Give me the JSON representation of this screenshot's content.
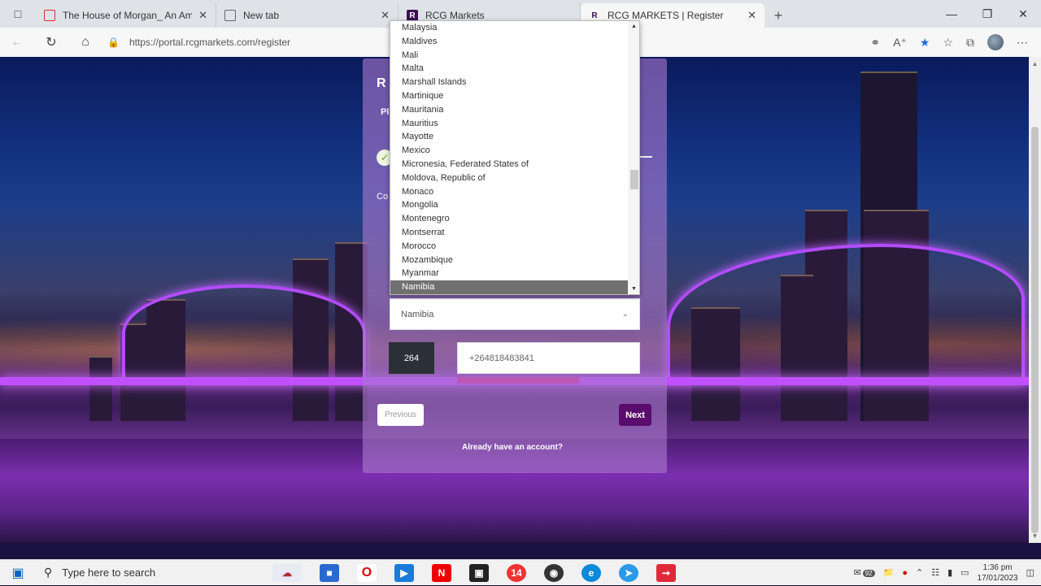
{
  "browser": {
    "tabs": [
      {
        "title": "The House of Morgan_ An Amer",
        "icon": "pdf-icon",
        "active": false
      },
      {
        "title": "New tab",
        "icon": "new-tab-icon",
        "active": false
      },
      {
        "title": "RCG Markets",
        "icon": "rcg-icon",
        "active": false
      },
      {
        "title": "RCG MARKETS | Register",
        "icon": "rcg-icon",
        "active": true
      }
    ],
    "url": "https://portal.rcgmarkets.com/register"
  },
  "modal": {
    "title": "R",
    "subtitle": "Pl",
    "country_label": "Co",
    "country_selected": "Namibia",
    "phone_code": "264",
    "phone_value": "+264818483841",
    "previous_label": "Previous",
    "next_label": "Next",
    "account_text": "Already have an account?"
  },
  "dropdown": {
    "options": [
      "Malaysia",
      "Maldives",
      "Mali",
      "Malta",
      "Marshall Islands",
      "Martinique",
      "Mauritania",
      "Mauritius",
      "Mayotte",
      "Mexico",
      "Micronesia, Federated States of",
      "Moldova, Republic of",
      "Monaco",
      "Mongolia",
      "Montenegro",
      "Montserrat",
      "Morocco",
      "Mozambique",
      "Myanmar",
      "Namibia"
    ],
    "selected": "Namibia"
  },
  "taskbar": {
    "search_placeholder": "Type here to search",
    "time": "1:36 pm",
    "date": "17/01/2023",
    "mail_badge": "92"
  },
  "colors": {
    "accent": "#5a0b6e",
    "modal_bg": "#aa78cd",
    "bridge": "#c050ff"
  }
}
